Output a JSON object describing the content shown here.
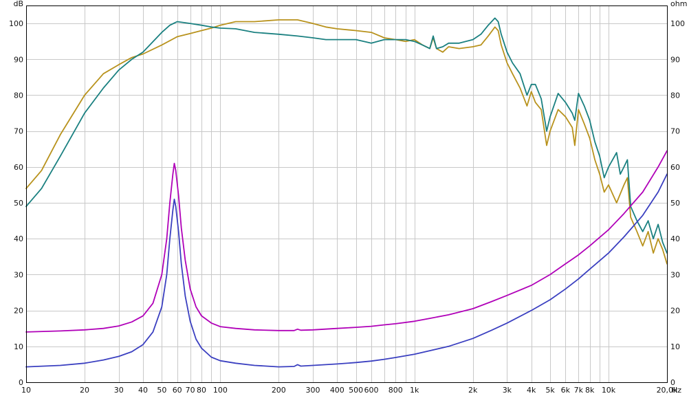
{
  "chart_data": {
    "type": "line",
    "x_scale": "log",
    "xlim": [
      10,
      20000
    ],
    "ylim": [
      0,
      105
    ],
    "y2lim": [
      0,
      105
    ],
    "grid": true,
    "left_unit": "dB",
    "right_unit": "ohm",
    "x_unit": "Hz",
    "x_ticks": [
      {
        "v": 10,
        "label": "10"
      },
      {
        "v": 20,
        "label": "20"
      },
      {
        "v": 30,
        "label": "30"
      },
      {
        "v": 40,
        "label": "40"
      },
      {
        "v": 50,
        "label": "50"
      },
      {
        "v": 60,
        "label": "60"
      },
      {
        "v": 70,
        "label": "70"
      },
      {
        "v": 80,
        "label": "80"
      },
      {
        "v": 100,
        "label": "100"
      },
      {
        "v": 200,
        "label": "200"
      },
      {
        "v": 300,
        "label": "300"
      },
      {
        "v": 400,
        "label": "400"
      },
      {
        "v": 500,
        "label": "500"
      },
      {
        "v": 600,
        "label": "600"
      },
      {
        "v": 800,
        "label": "800"
      },
      {
        "v": 1000,
        "label": "1k"
      },
      {
        "v": 2000,
        "label": "2k"
      },
      {
        "v": 3000,
        "label": "3k"
      },
      {
        "v": 4000,
        "label": "4k"
      },
      {
        "v": 5000,
        "label": "5k"
      },
      {
        "v": 6000,
        "label": "6k"
      },
      {
        "v": 7000,
        "label": "7k"
      },
      {
        "v": 8000,
        "label": "8k"
      },
      {
        "v": 10000,
        "label": "10k"
      },
      {
        "v": 20000,
        "label": "20,0k"
      }
    ],
    "y_ticks": [
      0,
      10,
      20,
      30,
      40,
      50,
      60,
      70,
      80,
      90,
      100
    ],
    "y2_ticks": [
      0,
      10,
      20,
      30,
      40,
      50,
      60,
      70,
      80,
      90,
      100
    ],
    "series": [
      {
        "color": "#b8921c",
        "axis": "left",
        "points": [
          [
            10,
            54
          ],
          [
            12,
            59
          ],
          [
            15,
            69
          ],
          [
            20,
            80
          ],
          [
            25,
            86
          ],
          [
            30,
            88.5
          ],
          [
            35,
            90.5
          ],
          [
            40,
            91.5
          ],
          [
            50,
            94
          ],
          [
            60,
            96.3
          ],
          [
            70,
            97.2
          ],
          [
            80,
            98
          ],
          [
            90,
            98.7
          ],
          [
            100,
            99.5
          ],
          [
            120,
            100.5
          ],
          [
            150,
            100.5
          ],
          [
            200,
            101
          ],
          [
            250,
            101
          ],
          [
            300,
            100
          ],
          [
            350,
            99
          ],
          [
            400,
            98.5
          ],
          [
            500,
            98
          ],
          [
            600,
            97.5
          ],
          [
            700,
            96
          ],
          [
            800,
            95.5
          ],
          [
            900,
            95
          ],
          [
            1000,
            95.5
          ],
          [
            1100,
            94
          ],
          [
            1200,
            93
          ],
          [
            1250,
            96
          ],
          [
            1300,
            93
          ],
          [
            1400,
            92
          ],
          [
            1500,
            93.5
          ],
          [
            1700,
            93
          ],
          [
            2000,
            93.5
          ],
          [
            2200,
            94
          ],
          [
            2400,
            96.5
          ],
          [
            2600,
            99
          ],
          [
            2700,
            98
          ],
          [
            2800,
            94
          ],
          [
            3000,
            89
          ],
          [
            3200,
            86
          ],
          [
            3500,
            82
          ],
          [
            3800,
            77
          ],
          [
            4000,
            81
          ],
          [
            4200,
            78
          ],
          [
            4500,
            76
          ],
          [
            4800,
            66
          ],
          [
            5000,
            70
          ],
          [
            5500,
            76
          ],
          [
            6000,
            74
          ],
          [
            6500,
            71
          ],
          [
            6700,
            66
          ],
          [
            7000,
            76
          ],
          [
            7500,
            72
          ],
          [
            8000,
            68
          ],
          [
            8500,
            62
          ],
          [
            9000,
            58
          ],
          [
            9500,
            53
          ],
          [
            10000,
            55
          ],
          [
            11000,
            50
          ],
          [
            12000,
            55
          ],
          [
            12500,
            57
          ],
          [
            13000,
            46
          ],
          [
            14000,
            42
          ],
          [
            15000,
            38
          ],
          [
            16000,
            42
          ],
          [
            17000,
            36
          ],
          [
            18000,
            40
          ],
          [
            19000,
            37
          ],
          [
            20000,
            33
          ]
        ]
      },
      {
        "color": "#1a8080",
        "axis": "left",
        "points": [
          [
            10,
            49
          ],
          [
            12,
            54
          ],
          [
            15,
            63
          ],
          [
            20,
            75
          ],
          [
            25,
            82
          ],
          [
            30,
            87
          ],
          [
            35,
            90
          ],
          [
            40,
            92
          ],
          [
            50,
            97.5
          ],
          [
            55,
            99.5
          ],
          [
            60,
            100.5
          ],
          [
            70,
            100
          ],
          [
            80,
            99.5
          ],
          [
            90,
            99
          ],
          [
            100,
            98.7
          ],
          [
            120,
            98.5
          ],
          [
            150,
            97.5
          ],
          [
            200,
            97
          ],
          [
            250,
            96.5
          ],
          [
            300,
            96
          ],
          [
            350,
            95.5
          ],
          [
            400,
            95.5
          ],
          [
            500,
            95.5
          ],
          [
            600,
            94.5
          ],
          [
            700,
            95.5
          ],
          [
            800,
            95.5
          ],
          [
            900,
            95.5
          ],
          [
            1000,
            95
          ],
          [
            1100,
            94
          ],
          [
            1200,
            93
          ],
          [
            1250,
            96.5
          ],
          [
            1300,
            93
          ],
          [
            1400,
            93.5
          ],
          [
            1500,
            94.5
          ],
          [
            1700,
            94.5
          ],
          [
            2000,
            95.5
          ],
          [
            2200,
            97
          ],
          [
            2400,
            99.5
          ],
          [
            2600,
            101.5
          ],
          [
            2700,
            100.5
          ],
          [
            2800,
            97
          ],
          [
            3000,
            92
          ],
          [
            3200,
            89
          ],
          [
            3500,
            86
          ],
          [
            3800,
            80
          ],
          [
            4000,
            83
          ],
          [
            4200,
            83
          ],
          [
            4500,
            79
          ],
          [
            4800,
            70
          ],
          [
            5000,
            74
          ],
          [
            5500,
            80.5
          ],
          [
            6000,
            78
          ],
          [
            6500,
            75
          ],
          [
            6700,
            73
          ],
          [
            7000,
            80.5
          ],
          [
            7500,
            77
          ],
          [
            8000,
            73
          ],
          [
            8500,
            67
          ],
          [
            9000,
            63
          ],
          [
            9500,
            57
          ],
          [
            10000,
            60
          ],
          [
            11000,
            64
          ],
          [
            11500,
            58
          ],
          [
            12000,
            60
          ],
          [
            12500,
            62
          ],
          [
            13000,
            49
          ],
          [
            14000,
            45
          ],
          [
            15000,
            42
          ],
          [
            16000,
            45
          ],
          [
            17000,
            40
          ],
          [
            18000,
            44
          ],
          [
            19000,
            39
          ],
          [
            20000,
            36
          ]
        ]
      },
      {
        "color": "#b000b8",
        "axis": "right",
        "points": [
          [
            10,
            14
          ],
          [
            15,
            14.3
          ],
          [
            20,
            14.6
          ],
          [
            25,
            15
          ],
          [
            30,
            15.7
          ],
          [
            35,
            16.8
          ],
          [
            40,
            18.5
          ],
          [
            45,
            22
          ],
          [
            50,
            30
          ],
          [
            53,
            40
          ],
          [
            55,
            50
          ],
          [
            57,
            58
          ],
          [
            58,
            61
          ],
          [
            59,
            59
          ],
          [
            61,
            52
          ],
          [
            63,
            43
          ],
          [
            66,
            34
          ],
          [
            70,
            26
          ],
          [
            75,
            21
          ],
          [
            80,
            18.5
          ],
          [
            90,
            16.5
          ],
          [
            100,
            15.5
          ],
          [
            120,
            15
          ],
          [
            150,
            14.6
          ],
          [
            200,
            14.4
          ],
          [
            240,
            14.4
          ],
          [
            250,
            14.8
          ],
          [
            260,
            14.5
          ],
          [
            300,
            14.6
          ],
          [
            400,
            15
          ],
          [
            500,
            15.3
          ],
          [
            600,
            15.6
          ],
          [
            700,
            16
          ],
          [
            800,
            16.3
          ],
          [
            1000,
            17
          ],
          [
            1200,
            17.8
          ],
          [
            1500,
            18.8
          ],
          [
            2000,
            20.5
          ],
          [
            2500,
            22.5
          ],
          [
            3000,
            24.2
          ],
          [
            4000,
            27
          ],
          [
            5000,
            30
          ],
          [
            6000,
            33
          ],
          [
            7000,
            35.5
          ],
          [
            8000,
            38
          ],
          [
            10000,
            42.5
          ],
          [
            12000,
            47
          ],
          [
            15000,
            53
          ],
          [
            18000,
            60
          ],
          [
            20000,
            64.5
          ]
        ]
      },
      {
        "color": "#3a3fc0",
        "axis": "right",
        "points": [
          [
            10,
            4.3
          ],
          [
            15,
            4.7
          ],
          [
            20,
            5.3
          ],
          [
            25,
            6.2
          ],
          [
            30,
            7.2
          ],
          [
            35,
            8.5
          ],
          [
            40,
            10.5
          ],
          [
            45,
            14
          ],
          [
            50,
            21
          ],
          [
            53,
            30
          ],
          [
            55,
            40
          ],
          [
            57,
            48
          ],
          [
            58,
            51
          ],
          [
            59,
            49
          ],
          [
            61,
            42
          ],
          [
            63,
            33
          ],
          [
            66,
            24
          ],
          [
            70,
            17
          ],
          [
            75,
            12
          ],
          [
            80,
            9.5
          ],
          [
            90,
            7
          ],
          [
            100,
            6
          ],
          [
            120,
            5.3
          ],
          [
            150,
            4.7
          ],
          [
            200,
            4.3
          ],
          [
            240,
            4.4
          ],
          [
            250,
            4.9
          ],
          [
            260,
            4.5
          ],
          [
            300,
            4.7
          ],
          [
            400,
            5.1
          ],
          [
            500,
            5.5
          ],
          [
            600,
            5.9
          ],
          [
            700,
            6.4
          ],
          [
            800,
            6.9
          ],
          [
            1000,
            7.8
          ],
          [
            1200,
            8.8
          ],
          [
            1500,
            10
          ],
          [
            2000,
            12.2
          ],
          [
            2500,
            14.5
          ],
          [
            3000,
            16.5
          ],
          [
            4000,
            20
          ],
          [
            5000,
            23
          ],
          [
            6000,
            26
          ],
          [
            7000,
            28.8
          ],
          [
            8000,
            31.5
          ],
          [
            10000,
            36
          ],
          [
            12000,
            40.5
          ],
          [
            15000,
            46.5
          ],
          [
            18000,
            53
          ],
          [
            20000,
            58
          ]
        ]
      }
    ]
  }
}
